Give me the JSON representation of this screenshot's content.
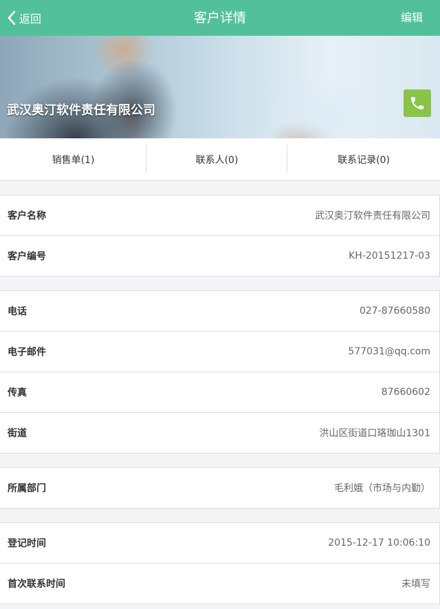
{
  "header": {
    "back_label": "返回",
    "title": "客户详情",
    "edit_label": "编辑",
    "background": "#52c19b"
  },
  "banner": {
    "company_name": "武汉奥汀软件责任有限公司",
    "phone_button_color": "#8bc34a",
    "phone_icon": "phone-icon"
  },
  "tabs": [
    {
      "label": "销售单(1)"
    },
    {
      "label": "联系人(0)"
    },
    {
      "label": "联系记录(0)"
    }
  ],
  "groups": [
    {
      "rows": [
        {
          "label": "客户名称",
          "value": "武汉奥汀软件责任有限公司"
        },
        {
          "label": "客户编号",
          "value": "KH-20151217-03"
        }
      ]
    },
    {
      "rows": [
        {
          "label": "电话",
          "value": "027-87660580"
        },
        {
          "label": "电子邮件",
          "value": "577031@qq.com"
        },
        {
          "label": "传真",
          "value": "87660602"
        },
        {
          "label": "街道",
          "value": "洪山区街道口珞珈山1301"
        }
      ]
    },
    {
      "rows": [
        {
          "label": "所属部门",
          "value": "毛利娥（市场与内勤）"
        }
      ]
    },
    {
      "rows": [
        {
          "label": "登记时间",
          "value": "2015-12-17 10:06:10"
        },
        {
          "label": "首次联系时间",
          "value": "未填写"
        }
      ]
    }
  ]
}
